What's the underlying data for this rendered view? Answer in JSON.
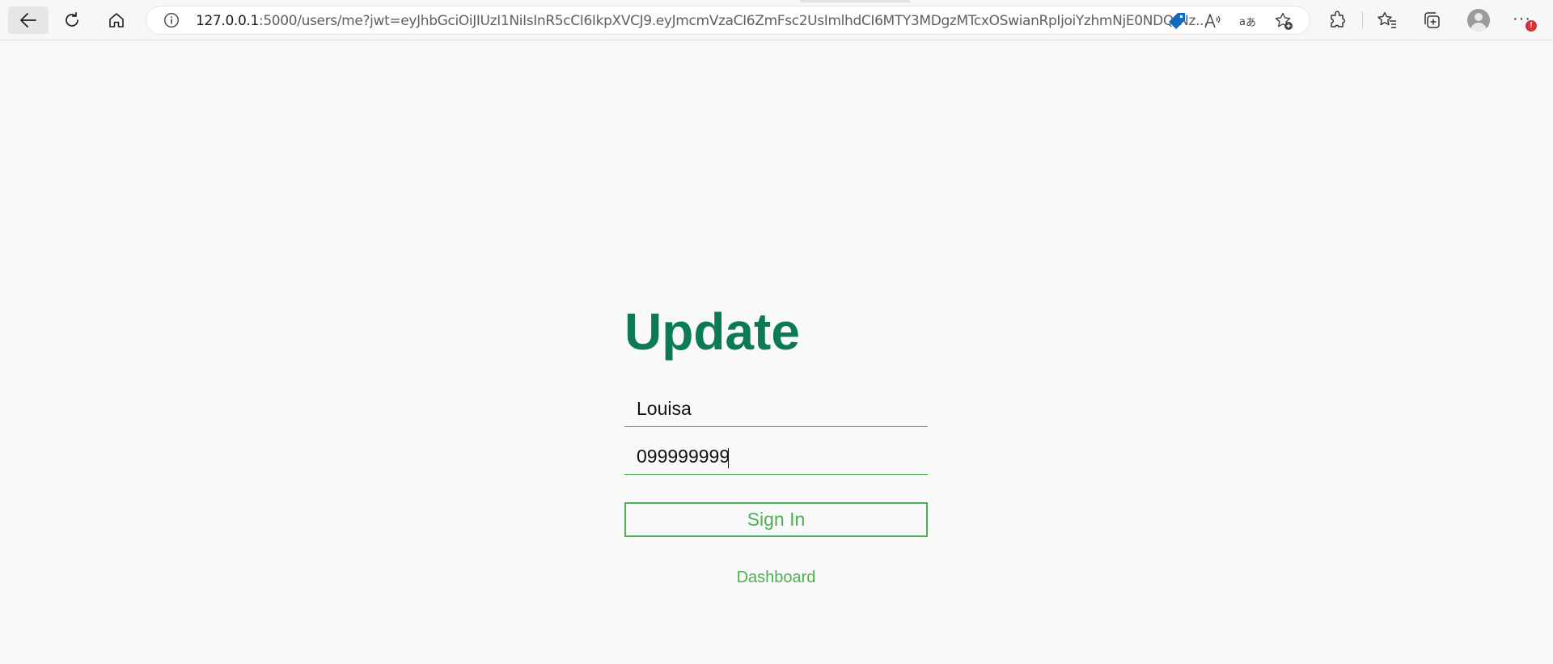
{
  "browser": {
    "url_host": "127.0.0.1",
    "url_rest": ":5000/users/me?jwt=eyJhbGciOiJIUzI1NiIsInR5cCI6IkpXVCJ9.eyJmcmVzaCI6ZmFsc2UsImlhdCI6MTY3MDgzMTcxOSwianRpIjoiYzhmNjE0NDQtNz...",
    "alert_badge": "!",
    "icons": {
      "back": "back-arrow-icon",
      "reload": "reload-icon",
      "home": "home-icon",
      "site_info": "info-icon",
      "coupon": "price-tag-icon",
      "read_aloud": "read-aloud-icon",
      "translate": "translate-icon",
      "add_favorite": "add-favorite-icon",
      "extensions": "extensions-icon",
      "favorites": "favorites-icon",
      "collections": "collections-icon",
      "profile": "profile-avatar-icon",
      "more": "more-menu-icon"
    },
    "colors": {
      "coupon": "#0f6cbd",
      "alert": "#d13438"
    }
  },
  "page": {
    "title": "Update",
    "name_value": "Louisa",
    "phone_value": "099999999",
    "submit_label": "Sign In",
    "dashboard_link": "Dashboard",
    "colors": {
      "title": "#0b7a55",
      "accent": "#4caf50"
    }
  }
}
